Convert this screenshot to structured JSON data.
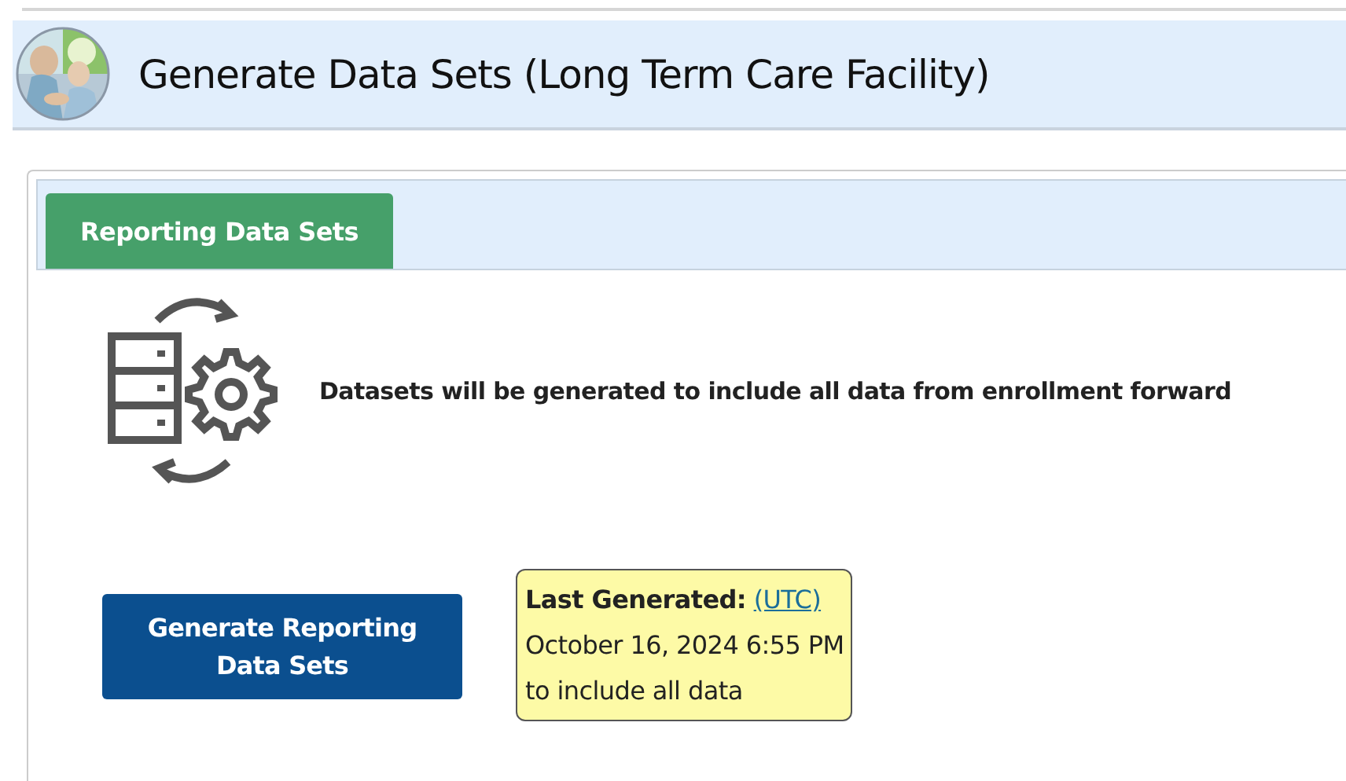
{
  "page": {
    "title": "Generate Data Sets (Long Term Care Facility)"
  },
  "tabs": [
    {
      "label": "Reporting Data Sets",
      "selected": true
    }
  ],
  "content": {
    "message": "Datasets will be generated to include all data from enrollment forward",
    "button": "Generate Reporting Data Sets",
    "last_generated": {
      "label": "Last Generated:",
      "link": "(UTC)",
      "date": "October 16, 2024 6:55 PM",
      "note": "to include all data"
    }
  }
}
